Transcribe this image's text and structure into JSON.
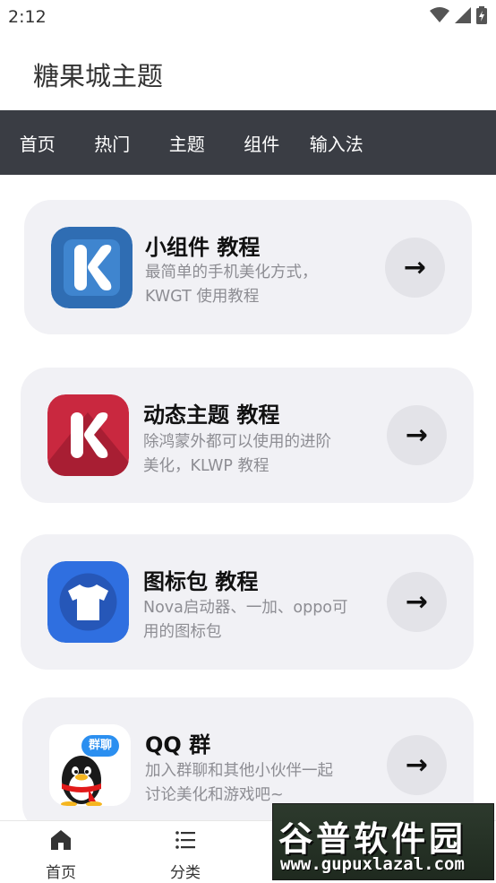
{
  "status_bar": {
    "time": "2:12"
  },
  "app_title": "糖果城主题",
  "nav_tabs": [
    {
      "label": "首页"
    },
    {
      "label": "热门"
    },
    {
      "label": "主题"
    },
    {
      "label": "组件"
    },
    {
      "label": "输入法"
    }
  ],
  "cards": [
    {
      "title": "小组件 教程",
      "desc": "最简单的手机美化方式，KWGT 使用教程",
      "icon": "kwgt-icon",
      "arrow": "→"
    },
    {
      "title": "动态主题 教程",
      "desc": "除鸿蒙外都可以使用的进阶美化，KLWP 教程",
      "icon": "klwp-icon",
      "arrow": "→"
    },
    {
      "title": "图标包 教程",
      "desc": "Nova启动器、一加、oppo可用的图标包",
      "icon": "tshirt-icon",
      "arrow": "→"
    },
    {
      "title": "QQ 群",
      "desc": "加入群聊和其他小伙伴一起讨论美化和游戏吧~",
      "icon": "qq-penguin-icon",
      "icon_badge": "群聊",
      "arrow": "→"
    }
  ],
  "bottom_nav": [
    {
      "label": "首页",
      "icon": "home-icon"
    },
    {
      "label": "分类",
      "icon": "list-icon"
    }
  ],
  "watermark": {
    "text": "谷普软件园",
    "url": "www.gupuxlazal.com"
  },
  "colors": {
    "nav_bg": "#3a3d44",
    "card_bg": "#f1f1f5",
    "kwgt": "#2f6db3",
    "klwp": "#c9283f",
    "iconpack": "#2f6fe0"
  }
}
